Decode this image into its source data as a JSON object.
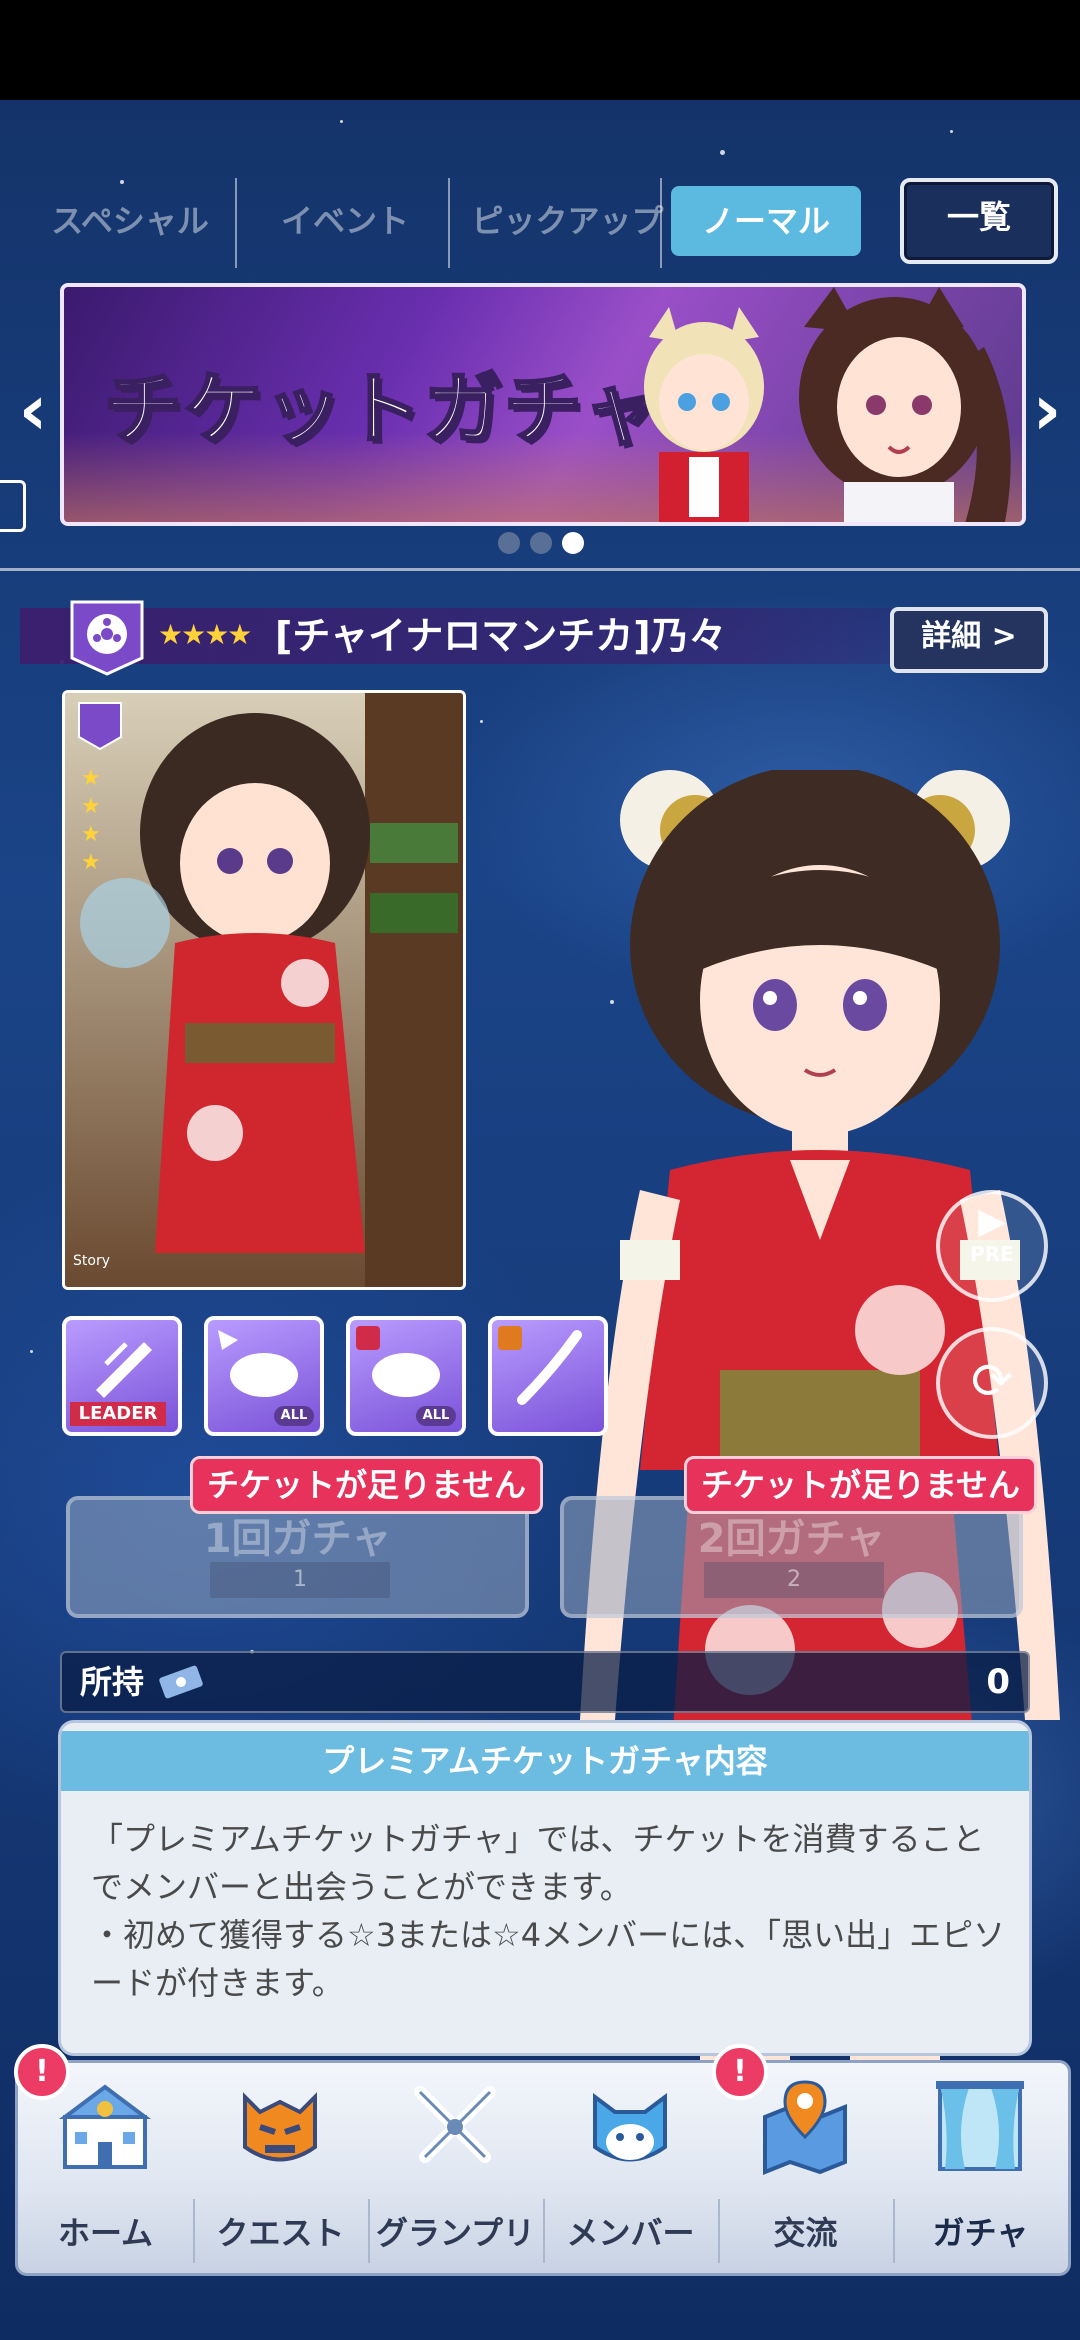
{
  "tabs": [
    {
      "label": "スペシャル"
    },
    {
      "label": "イベント"
    },
    {
      "label": "ピックアップ"
    },
    {
      "label": "ノーマル"
    }
  ],
  "list_button": "一覧",
  "banner": {
    "title": "チケットガチャ",
    "page_total": 3,
    "page_active": 3
  },
  "card": {
    "rarity": "★★★★",
    "name": "[チャイナロマンチカ]乃々",
    "detail_button": "詳細 >",
    "story_label": "Story"
  },
  "skills": [
    {
      "name": "leader-skill",
      "tag": "LEADER"
    },
    {
      "name": "skill-2",
      "tag": "ALL"
    },
    {
      "name": "skill-3",
      "tag": "ALL"
    },
    {
      "name": "skill-4",
      "tag": ""
    }
  ],
  "side_buttons": {
    "preview": "PRE"
  },
  "gacha": {
    "single": {
      "title": "1回ガチャ",
      "cost": "1",
      "warning": "チケットが足りません"
    },
    "double": {
      "title": "2回ガチャ",
      "cost": "2",
      "warning": "チケットが足りません"
    }
  },
  "owned": {
    "label": "所持",
    "value": "0"
  },
  "info": {
    "title": "プレミアムチケットガチャ内容",
    "body": "「プレミアムチケットガチャ」では、チケットを消費することでメンバーと出会うことができます。\n・初めて獲得する☆3または☆4メンバーには、「思い出」エピソードが付きます。"
  },
  "nav": [
    {
      "label": "ホーム",
      "icon": "school-icon",
      "badge": "!"
    },
    {
      "label": "クエスト",
      "icon": "demon-mask-icon",
      "badge": ""
    },
    {
      "label": "グランプリ",
      "icon": "crossed-swords-icon",
      "badge": ""
    },
    {
      "label": "メンバー",
      "icon": "member-cat-icon",
      "badge": ""
    },
    {
      "label": "交流",
      "icon": "map-pin-icon",
      "badge": "!"
    },
    {
      "label": "ガチャ",
      "icon": "curtain-window-icon",
      "badge": ""
    }
  ],
  "colors": {
    "tab_active": "#5cb9df",
    "warning": "#e7335c",
    "info_header": "#6bbce0",
    "badge": "#ec3b64"
  }
}
